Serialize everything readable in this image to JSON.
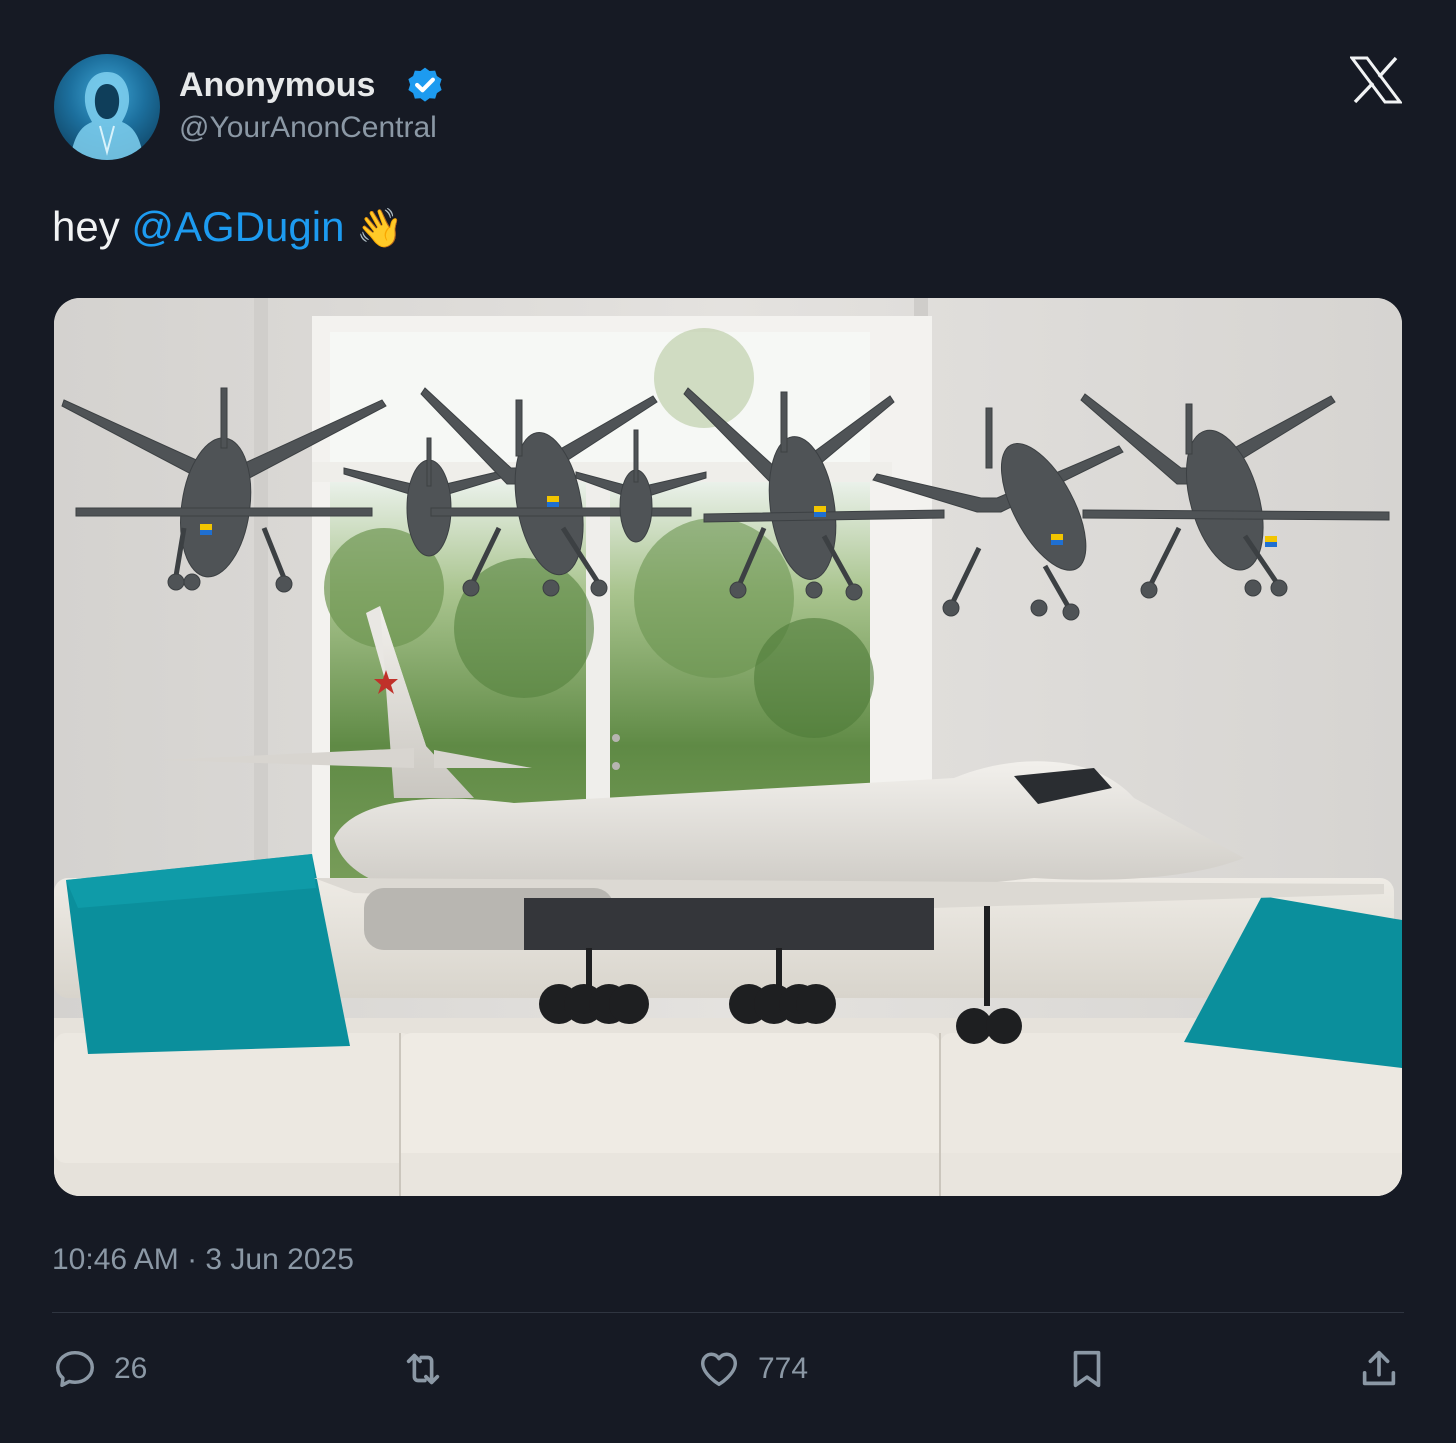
{
  "author": {
    "display_name": "Anonymous",
    "handle": "@YourAnonCentral",
    "verified": true,
    "avatar_icon": "hooded-figure-avatar"
  },
  "brand": {
    "logo_icon": "x-logo-icon"
  },
  "tweet": {
    "text_prefix": "hey",
    "mention": "@AGDugin",
    "emoji": "👋",
    "media_icon": "photo-model-bomber-and-drones-on-sofa"
  },
  "meta": {
    "timestamp": "10:46 AM · 3 Jun 2025"
  },
  "actions": {
    "reply": {
      "icon": "reply-bubble-icon",
      "count": "26"
    },
    "retweet": {
      "icon": "retweet-icon"
    },
    "like": {
      "icon": "heart-icon",
      "count": "774"
    },
    "bookmark": {
      "icon": "bookmark-icon"
    },
    "share": {
      "icon": "share-icon"
    }
  },
  "colors": {
    "background": "#161a24",
    "mention": "#1d9bf0",
    "verified": "#1d9bf0",
    "muted": "#8b98a5",
    "text": "#e7e9ea"
  }
}
